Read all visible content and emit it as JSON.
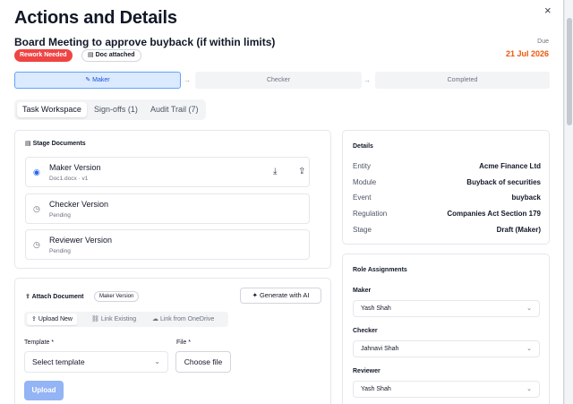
{
  "window": {
    "close_glyph": "×",
    "title": "Actions and Details"
  },
  "task": {
    "subtitle": "Board Meeting to approve buyback (if within limits)",
    "badge_status": "Rework Needed",
    "badge_doc": "Doc attached",
    "due_label": "Due",
    "due_date": "21 Jul 2026"
  },
  "stepper": {
    "steps": [
      {
        "label": "Maker",
        "active": true
      },
      {
        "label": "Checker",
        "active": false
      },
      {
        "label": "Completed",
        "active": false
      }
    ],
    "arrow_glyph": "→"
  },
  "tabs": [
    {
      "label": "Task Workspace",
      "active": true
    },
    {
      "label": "Sign-offs (1)",
      "active": false
    },
    {
      "label": "Audit Trail (7)",
      "active": false
    }
  ],
  "stage_documents": {
    "title": "Stage Documents",
    "items": [
      {
        "name": "Maker Version",
        "meta": "Doc1.docx · v1",
        "status": "done"
      },
      {
        "name": "Checker Version",
        "meta": "Pending",
        "status": "pending"
      },
      {
        "name": "Reviewer Version",
        "meta": "Pending",
        "status": "pending"
      }
    ]
  },
  "attach": {
    "title": "Attach Document",
    "version_badge": "Maker Version",
    "generate_label": "Generate with AI",
    "subtabs": [
      {
        "label": "Upload New",
        "active": true
      },
      {
        "label": "Link Existing",
        "active": false
      },
      {
        "label": "Link from OneDrive",
        "active": false
      }
    ],
    "template_label": "Template *",
    "template_value": "Select template",
    "file_label": "File *",
    "file_button": "Choose file",
    "upload_button": "Upload"
  },
  "details": {
    "title": "Details",
    "rows": [
      {
        "key": "Entity",
        "value": "Acme Finance Ltd"
      },
      {
        "key": "Module",
        "value": "Buyback of securities"
      },
      {
        "key": "Event",
        "value": "buyback"
      },
      {
        "key": "Regulation",
        "value": "Companies Act Section 179"
      },
      {
        "key": "Stage",
        "value": "Draft (Maker)"
      }
    ]
  },
  "roles": {
    "title": "Role Assignments",
    "items": [
      {
        "role": "Maker",
        "value": "Yash Shah"
      },
      {
        "role": "Checker",
        "value": "Jahnavi Shah"
      },
      {
        "role": "Reviewer",
        "value": "Yash Shah"
      }
    ]
  },
  "colors": {
    "accent": "#2563eb",
    "danger": "#ef4444",
    "due": "#ea580c",
    "primary_disabled": "#93b4f5"
  }
}
